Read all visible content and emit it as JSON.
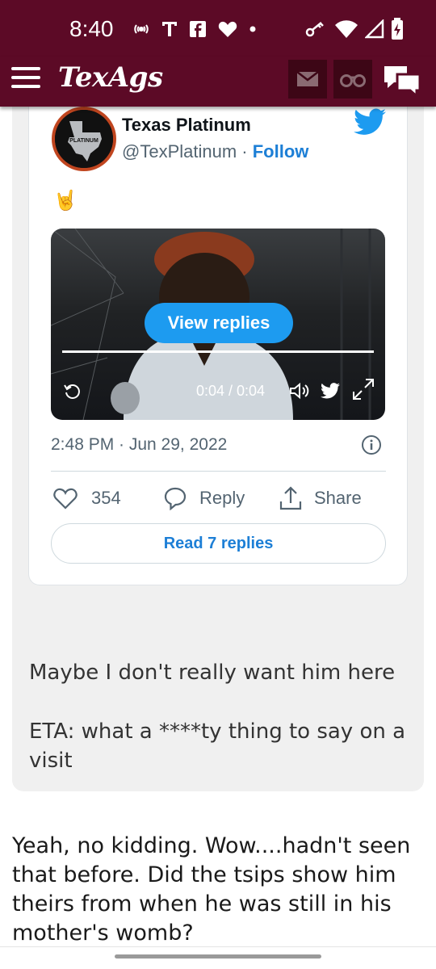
{
  "status_bar": {
    "time": "8:40",
    "left_icons": [
      "podcast-icon",
      "t-mobile-icon",
      "facebook-icon",
      "heart-icon",
      "dot-icon"
    ],
    "right_icons": [
      "key-icon",
      "wifi-icon",
      "signal-icon",
      "battery-charging-icon"
    ]
  },
  "app_bar": {
    "logo": "TexAgs",
    "buttons": [
      "mail-icon",
      "binoculars-icon",
      "chat-icon"
    ],
    "brand_color": "#5c0a26"
  },
  "tweet": {
    "author_name": "Texas Platinum",
    "handle": "@TexPlatinum",
    "separator": " · ",
    "follow": "Follow",
    "avatar_text": "PLATINUM",
    "emoji": "🤘",
    "video": {
      "view_replies": "View replies",
      "time": "0:04 / 0:04"
    },
    "date": "2:48 PM · Jun 29, 2022",
    "likes": "354",
    "reply": "Reply",
    "share": "Share",
    "read_replies": "Read 7 replies",
    "accent": "#1d9bf0"
  },
  "quote": {
    "line1": "Maybe I don't really want him here",
    "line2": "ETA: what a ****ty thing to say on a visit"
  },
  "post": {
    "text": "Yeah, no kidding. Wow....hadn't seen that before. Did the tsips show him theirs from when he was still in his mother's womb?"
  }
}
